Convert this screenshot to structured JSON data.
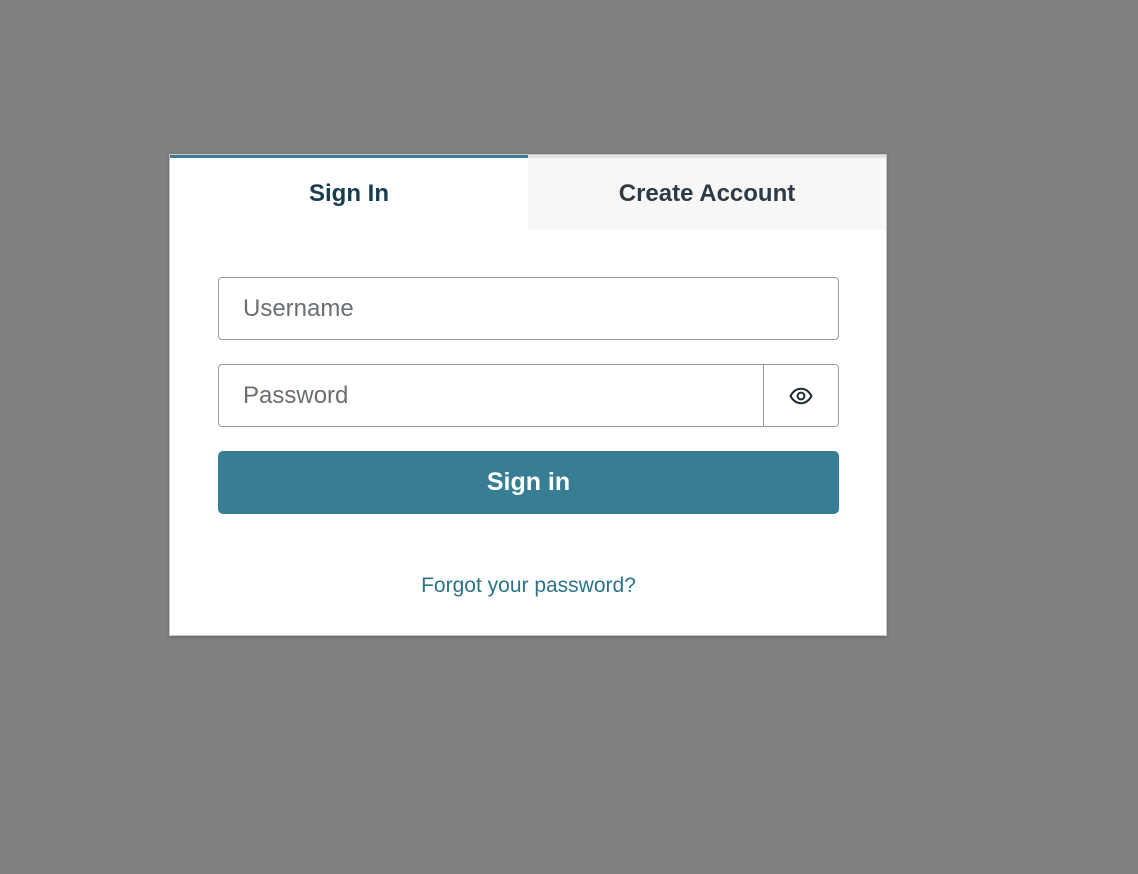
{
  "tabs": {
    "sign_in": "Sign In",
    "create_account": "Create Account"
  },
  "form": {
    "username_placeholder": "Username",
    "username_value": "",
    "password_placeholder": "Password",
    "password_value": "",
    "show_password_icon": "eye-icon",
    "submit_label": "Sign in",
    "forgot_link": "Forgot your password?"
  },
  "colors": {
    "background": "#808080",
    "accent": "#377e94",
    "active_tab_text": "#173e4f",
    "link": "#2c7388"
  }
}
